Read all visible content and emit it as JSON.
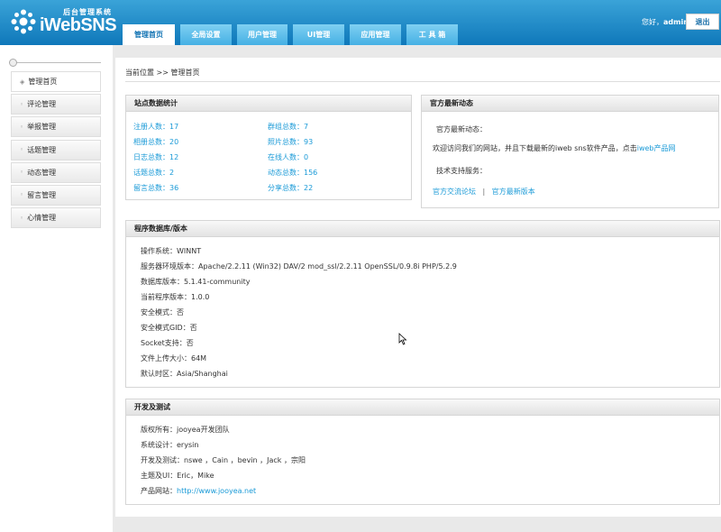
{
  "header": {
    "logo_subtitle": "后台管理系统",
    "logo_name": "iWebSNS",
    "greeting_prefix": "您好，",
    "username": "admin",
    "logout_label": "退出"
  },
  "nav": {
    "tabs": [
      {
        "label": "管理首页"
      },
      {
        "label": "全局设置"
      },
      {
        "label": "用户管理"
      },
      {
        "label": "UI管理"
      },
      {
        "label": "应用管理"
      },
      {
        "label": "工 具 箱"
      }
    ]
  },
  "sidebar": {
    "items": [
      {
        "label": "管理首页"
      },
      {
        "label": "评论管理"
      },
      {
        "label": "举报管理"
      },
      {
        "label": "话题管理"
      },
      {
        "label": "动态管理"
      },
      {
        "label": "留言管理"
      },
      {
        "label": "心情管理"
      }
    ]
  },
  "breadcrumb": {
    "prefix": "当前位置",
    "separator": ">>",
    "current": "管理首页"
  },
  "stats": {
    "title": "站点数据统计",
    "items": [
      {
        "label": "注册人数：17"
      },
      {
        "label": "群组总数：7"
      },
      {
        "label": "相册总数：20"
      },
      {
        "label": "照片总数：93"
      },
      {
        "label": "日志总数：12"
      },
      {
        "label": "在线人数：0"
      },
      {
        "label": "话题总数：2"
      },
      {
        "label": "动态总数：156"
      },
      {
        "label": "留言总数：36"
      },
      {
        "label": "分享总数：22"
      }
    ]
  },
  "news": {
    "title": "官方最新动态",
    "latest_label": "官方最新动态：",
    "welcome_text": "欢迎访问我们的网站，并且下载最新的iweb sns软件产品，点击",
    "welcome_link": "iweb产品网",
    "support_label": "技术支持服务：",
    "forum_link": "官方交流论坛",
    "divider": "|",
    "latest_version_link": "官方最新版本"
  },
  "env": {
    "title": "程序数据库/版本",
    "lines": [
      "操作系统：WINNT",
      "服务器环境版本：Apache/2.2.11 (Win32) DAV/2 mod_ssl/2.2.11 OpenSSL/0.9.8i PHP/5.2.9",
      "数据库版本：5.1.41-community",
      "当前程序版本：1.0.0",
      "安全模式：否",
      "安全模式GID：否",
      "Socket支持：否",
      "文件上传大小：64M",
      "默认时区：Asia/Shanghai"
    ]
  },
  "dev": {
    "title": "开发及测试",
    "lines": [
      "版权所有：jooyea开发团队",
      "系统设计：erysin",
      "开发及测试：nswe ，Cain ，bevin ，Jack ，宗阳",
      "主题及UI：Eric，Mike"
    ],
    "website_label": "产品网站：",
    "website_url": "http://www.jooyea.net"
  },
  "colors": {
    "header_top": "#3aa3d8",
    "header_bottom": "#0f78ba",
    "link": "#1a9ad7",
    "main_bg": "#e9e9e9"
  }
}
